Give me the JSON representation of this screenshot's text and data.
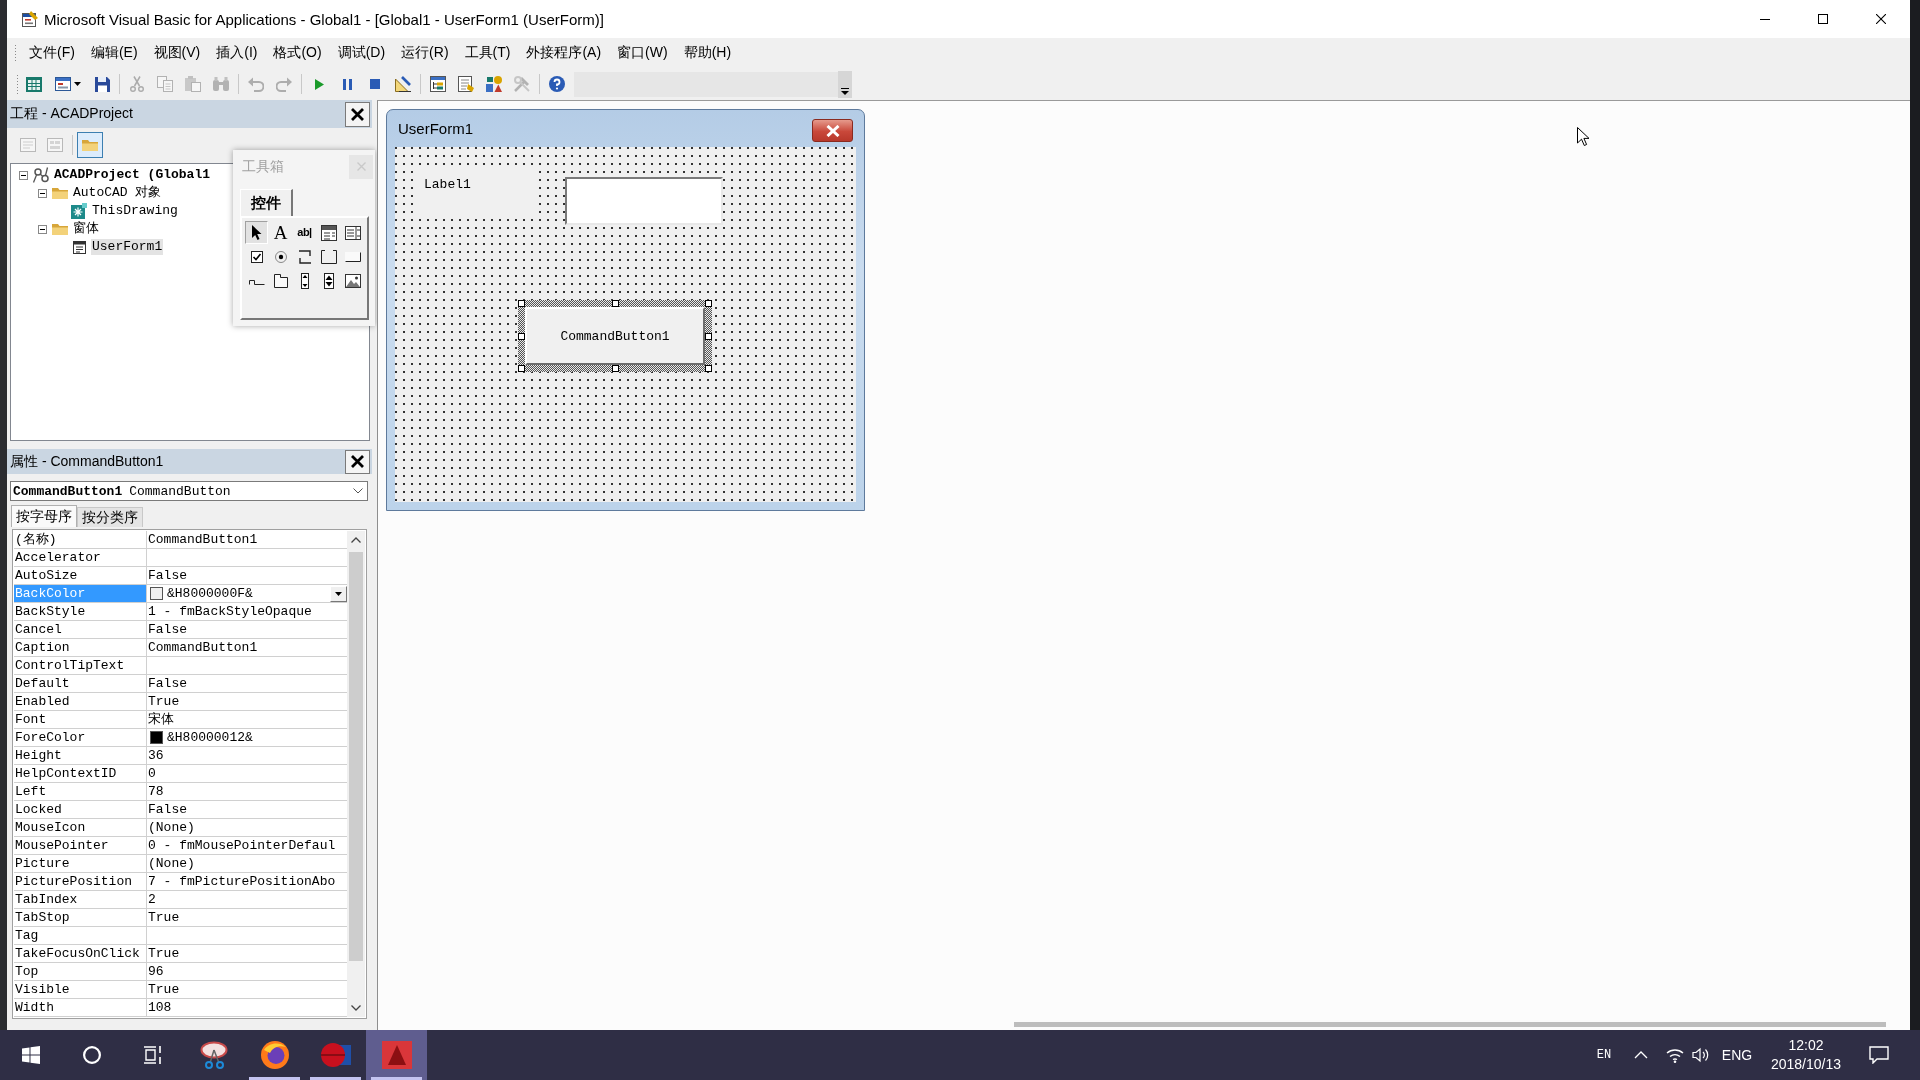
{
  "window": {
    "title": "Microsoft Visual Basic for Applications - Global1 - [Global1 - UserForm1 (UserForm)]"
  },
  "menu": [
    "文件(F)",
    "编辑(E)",
    "视图(V)",
    "插入(I)",
    "格式(O)",
    "调试(D)",
    "运行(R)",
    "工具(T)",
    "外接程序(A)",
    "窗口(W)",
    "帮助(H)"
  ],
  "toolbar": {
    "groups": [
      [
        {
          "kind": "host",
          "disabled": false
        },
        {
          "kind": "insert-form",
          "disabled": false
        },
        {
          "kind": "save",
          "disabled": false
        }
      ],
      [
        {
          "kind": "cut",
          "disabled": true
        },
        {
          "kind": "copy",
          "disabled": true
        },
        {
          "kind": "paste",
          "disabled": true
        },
        {
          "kind": "find",
          "disabled": true
        }
      ],
      [
        {
          "kind": "undo",
          "disabled": true
        },
        {
          "kind": "redo",
          "disabled": true
        }
      ],
      [
        {
          "kind": "run",
          "disabled": false
        },
        {
          "kind": "pause",
          "disabled": false
        },
        {
          "kind": "stop",
          "disabled": false
        },
        {
          "kind": "design-mode",
          "disabled": false
        }
      ],
      [
        {
          "kind": "project-explorer",
          "disabled": false
        },
        {
          "kind": "properties",
          "disabled": false
        },
        {
          "kind": "object-browser",
          "disabled": false
        },
        {
          "kind": "toolbox",
          "disabled": true
        }
      ],
      [
        {
          "kind": "help",
          "disabled": false
        }
      ]
    ]
  },
  "project_panel": {
    "title": "工程 - ACADProject",
    "buttons": [
      {
        "kind": "view-code",
        "disabled": true,
        "pressed": false
      },
      {
        "kind": "view-object",
        "disabled": true,
        "pressed": false
      },
      {
        "kind": "toggle-folders",
        "disabled": false,
        "pressed": true
      }
    ],
    "tree": [
      {
        "kind": "project",
        "label": "ACADProject (Global1",
        "expanded": true,
        "selected": false,
        "children": [
          {
            "kind": "folder",
            "label": "AutoCAD 对象",
            "expanded": true,
            "selected": false,
            "children": [
              {
                "kind": "document",
                "label": "ThisDrawing",
                "selected": false
              }
            ]
          },
          {
            "kind": "folder",
            "label": "窗体",
            "expanded": true,
            "selected": false,
            "children": [
              {
                "kind": "form",
                "label": "UserForm1",
                "selected": true
              }
            ]
          }
        ]
      }
    ]
  },
  "toolbox": {
    "title": "工具箱",
    "active": false,
    "tabs": [
      {
        "label": "控件",
        "selected": true
      }
    ],
    "tools": [
      {
        "kind": "pointer",
        "selected": true
      },
      {
        "kind": "label",
        "glyph": "A",
        "selected": false
      },
      {
        "kind": "textbox",
        "glyph": "ab|",
        "selected": false
      },
      {
        "kind": "combobox",
        "selected": false
      },
      {
        "kind": "listbox",
        "selected": false
      },
      {
        "kind": "checkbox",
        "selected": false
      },
      {
        "kind": "optionbutton",
        "selected": false
      },
      {
        "kind": "togglebutton",
        "selected": false
      },
      {
        "kind": "frame",
        "selected": false
      },
      {
        "kind": "commandbutton",
        "selected": false
      },
      {
        "kind": "tabstrip",
        "selected": false
      },
      {
        "kind": "multipage",
        "selected": false
      },
      {
        "kind": "scrollbar",
        "selected": false
      },
      {
        "kind": "spinbutton",
        "selected": false
      },
      {
        "kind": "image",
        "selected": false
      }
    ]
  },
  "properties_panel": {
    "title": "属性 - CommandButton1",
    "object_name": "CommandButton1",
    "object_type": "CommandButton",
    "tabs": [
      {
        "label": "按字母序",
        "selected": true
      },
      {
        "label": "按分类序",
        "selected": false
      }
    ],
    "rows": [
      {
        "name": "(名称)",
        "value": "CommandButton1",
        "selected": false
      },
      {
        "name": "Accelerator",
        "selected": false
      },
      {
        "name": "AutoSize",
        "value": "False",
        "selected": false
      },
      {
        "name": "BackColor",
        "value": "&H8000000F&",
        "color": "#f0f0f0",
        "selected": true
      },
      {
        "name": "BackStyle",
        "value": "1 - fmBackStyleOpaque",
        "selected": false
      },
      {
        "name": "Cancel",
        "value": "False",
        "selected": false
      },
      {
        "name": "Caption",
        "value": "CommandButton1",
        "selected": false
      },
      {
        "name": "ControlTipText",
        "selected": false
      },
      {
        "name": "Default",
        "value": "False",
        "selected": false
      },
      {
        "name": "Enabled",
        "value": "True",
        "selected": false
      },
      {
        "name": "Font",
        "value": "宋体",
        "selected": false
      },
      {
        "name": "ForeColor",
        "value": "&H80000012&",
        "color": "#000000",
        "selected": false
      },
      {
        "name": "Height",
        "value": "36",
        "selected": false
      },
      {
        "name": "HelpContextID",
        "value": "0",
        "selected": false
      },
      {
        "name": "Left",
        "value": "78",
        "selected": false
      },
      {
        "name": "Locked",
        "value": "False",
        "selected": false
      },
      {
        "name": "MouseIcon",
        "value": "(None)",
        "selected": false
      },
      {
        "name": "MousePointer",
        "value": "0 - fmMousePointerDefaul",
        "selected": false
      },
      {
        "name": "Picture",
        "value": "(None)",
        "selected": false
      },
      {
        "name": "PicturePosition",
        "value": "7 - fmPicturePositionAbo",
        "selected": false
      },
      {
        "name": "TabIndex",
        "value": "2",
        "selected": false
      },
      {
        "name": "TabStop",
        "value": "True",
        "selected": false
      },
      {
        "name": "Tag",
        "selected": false
      },
      {
        "name": "TakeFocusOnClick",
        "value": "True",
        "selected": false
      },
      {
        "name": "Top",
        "value": "96",
        "selected": false
      },
      {
        "name": "Visible",
        "value": "True",
        "selected": false
      },
      {
        "name": "Width",
        "value": "108",
        "selected": false
      }
    ]
  },
  "form_designer": {
    "title": "UserForm1",
    "controls": [
      {
        "kind": "label",
        "caption": "Label1",
        "selected": false
      },
      {
        "kind": "textbox",
        "selected": false
      },
      {
        "kind": "button",
        "caption": "CommandButton1",
        "selected": true
      }
    ]
  },
  "taskbar": {
    "buttons": [
      {
        "kind": "start"
      },
      {
        "kind": "search"
      },
      {
        "kind": "task-view"
      }
    ],
    "apps": [
      {
        "kind": "scissors",
        "running": false,
        "active": false
      },
      {
        "kind": "globe",
        "running": true,
        "active": false
      },
      {
        "kind": "disc",
        "running": true,
        "active": false
      },
      {
        "kind": "triangle",
        "running": true,
        "active": true
      }
    ],
    "tray": {
      "input_mode": "EN",
      "language": "ENG",
      "time": "12:02",
      "date": "2018/10/13"
    }
  }
}
